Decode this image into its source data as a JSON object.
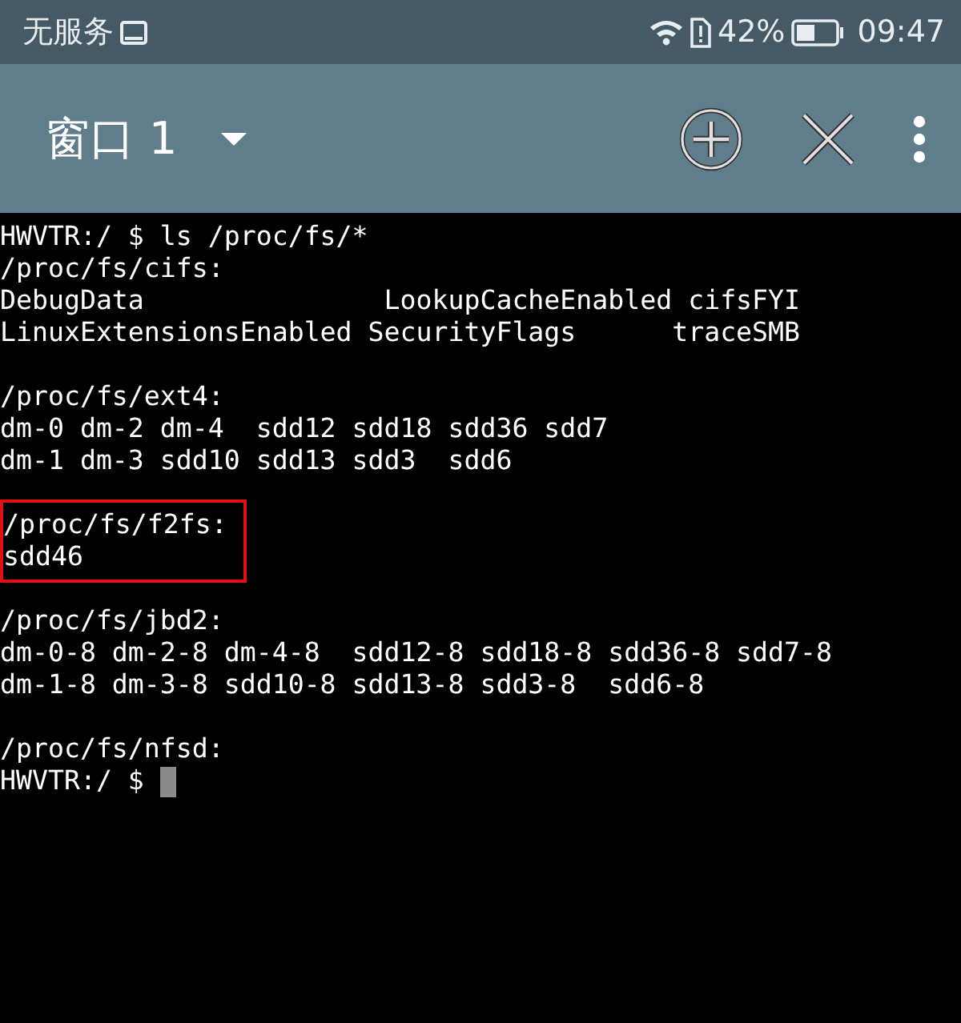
{
  "status_bar": {
    "carrier": "无服务",
    "battery": "42%",
    "time": "09:47"
  },
  "toolbar": {
    "title": "窗口 1"
  },
  "terminal": {
    "groups": [
      {
        "highlighted": false,
        "lines": [
          "HWVTR:/ $ ls /proc/fs/*",
          "/proc/fs/cifs:",
          "DebugData               LookupCacheEnabled cifsFYI",
          "LinuxExtensionsEnabled SecurityFlags      traceSMB"
        ]
      },
      {
        "highlighted": false,
        "lines": [
          "/proc/fs/ext4:",
          "dm-0 dm-2 dm-4  sdd12 sdd18 sdd36 sdd7",
          "dm-1 dm-3 sdd10 sdd13 sdd3  sdd6"
        ]
      },
      {
        "highlighted": true,
        "lines": [
          "/proc/fs/f2fs:",
          "sdd46"
        ]
      },
      {
        "highlighted": false,
        "lines": [
          "/proc/fs/jbd2:",
          "dm-0-8 dm-2-8 dm-4-8  sdd12-8 sdd18-8 sdd36-8 sdd7-8",
          "dm-1-8 dm-3-8 sdd10-8 sdd13-8 sdd3-8  sdd6-8"
        ]
      },
      {
        "highlighted": false,
        "lines": [
          "/proc/fs/nfsd:"
        ]
      }
    ],
    "prompt": {
      "text": "HWVTR:/ $",
      "cursor": true
    }
  }
}
